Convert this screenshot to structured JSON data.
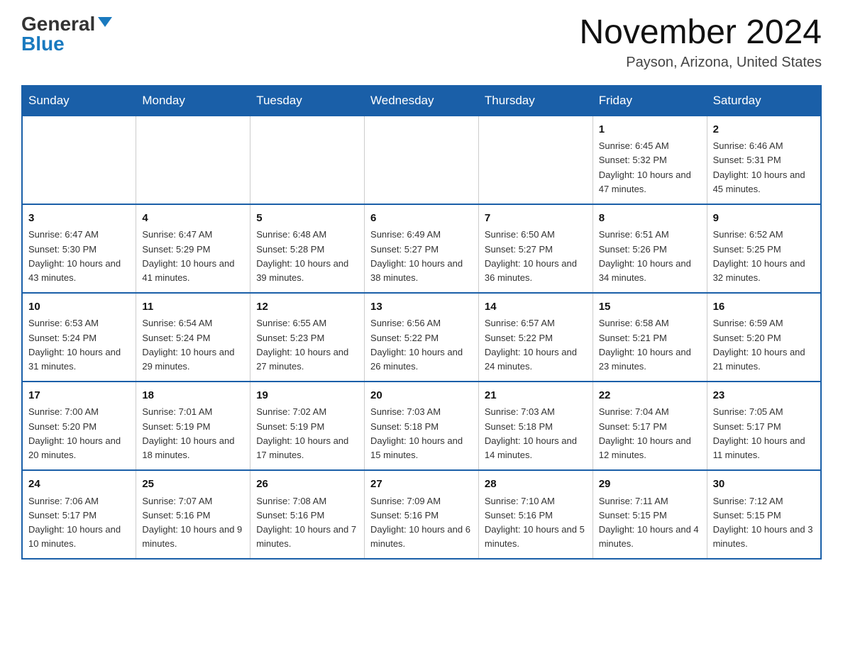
{
  "header": {
    "logo_general": "General",
    "logo_blue": "Blue",
    "title": "November 2024",
    "subtitle": "Payson, Arizona, United States"
  },
  "days_of_week": [
    "Sunday",
    "Monday",
    "Tuesday",
    "Wednesday",
    "Thursday",
    "Friday",
    "Saturday"
  ],
  "weeks": [
    [
      {
        "day": "",
        "info": ""
      },
      {
        "day": "",
        "info": ""
      },
      {
        "day": "",
        "info": ""
      },
      {
        "day": "",
        "info": ""
      },
      {
        "day": "",
        "info": ""
      },
      {
        "day": "1",
        "info": "Sunrise: 6:45 AM\nSunset: 5:32 PM\nDaylight: 10 hours and 47 minutes."
      },
      {
        "day": "2",
        "info": "Sunrise: 6:46 AM\nSunset: 5:31 PM\nDaylight: 10 hours and 45 minutes."
      }
    ],
    [
      {
        "day": "3",
        "info": "Sunrise: 6:47 AM\nSunset: 5:30 PM\nDaylight: 10 hours and 43 minutes."
      },
      {
        "day": "4",
        "info": "Sunrise: 6:47 AM\nSunset: 5:29 PM\nDaylight: 10 hours and 41 minutes."
      },
      {
        "day": "5",
        "info": "Sunrise: 6:48 AM\nSunset: 5:28 PM\nDaylight: 10 hours and 39 minutes."
      },
      {
        "day": "6",
        "info": "Sunrise: 6:49 AM\nSunset: 5:27 PM\nDaylight: 10 hours and 38 minutes."
      },
      {
        "day": "7",
        "info": "Sunrise: 6:50 AM\nSunset: 5:27 PM\nDaylight: 10 hours and 36 minutes."
      },
      {
        "day": "8",
        "info": "Sunrise: 6:51 AM\nSunset: 5:26 PM\nDaylight: 10 hours and 34 minutes."
      },
      {
        "day": "9",
        "info": "Sunrise: 6:52 AM\nSunset: 5:25 PM\nDaylight: 10 hours and 32 minutes."
      }
    ],
    [
      {
        "day": "10",
        "info": "Sunrise: 6:53 AM\nSunset: 5:24 PM\nDaylight: 10 hours and 31 minutes."
      },
      {
        "day": "11",
        "info": "Sunrise: 6:54 AM\nSunset: 5:24 PM\nDaylight: 10 hours and 29 minutes."
      },
      {
        "day": "12",
        "info": "Sunrise: 6:55 AM\nSunset: 5:23 PM\nDaylight: 10 hours and 27 minutes."
      },
      {
        "day": "13",
        "info": "Sunrise: 6:56 AM\nSunset: 5:22 PM\nDaylight: 10 hours and 26 minutes."
      },
      {
        "day": "14",
        "info": "Sunrise: 6:57 AM\nSunset: 5:22 PM\nDaylight: 10 hours and 24 minutes."
      },
      {
        "day": "15",
        "info": "Sunrise: 6:58 AM\nSunset: 5:21 PM\nDaylight: 10 hours and 23 minutes."
      },
      {
        "day": "16",
        "info": "Sunrise: 6:59 AM\nSunset: 5:20 PM\nDaylight: 10 hours and 21 minutes."
      }
    ],
    [
      {
        "day": "17",
        "info": "Sunrise: 7:00 AM\nSunset: 5:20 PM\nDaylight: 10 hours and 20 minutes."
      },
      {
        "day": "18",
        "info": "Sunrise: 7:01 AM\nSunset: 5:19 PM\nDaylight: 10 hours and 18 minutes."
      },
      {
        "day": "19",
        "info": "Sunrise: 7:02 AM\nSunset: 5:19 PM\nDaylight: 10 hours and 17 minutes."
      },
      {
        "day": "20",
        "info": "Sunrise: 7:03 AM\nSunset: 5:18 PM\nDaylight: 10 hours and 15 minutes."
      },
      {
        "day": "21",
        "info": "Sunrise: 7:03 AM\nSunset: 5:18 PM\nDaylight: 10 hours and 14 minutes."
      },
      {
        "day": "22",
        "info": "Sunrise: 7:04 AM\nSunset: 5:17 PM\nDaylight: 10 hours and 12 minutes."
      },
      {
        "day": "23",
        "info": "Sunrise: 7:05 AM\nSunset: 5:17 PM\nDaylight: 10 hours and 11 minutes."
      }
    ],
    [
      {
        "day": "24",
        "info": "Sunrise: 7:06 AM\nSunset: 5:17 PM\nDaylight: 10 hours and 10 minutes."
      },
      {
        "day": "25",
        "info": "Sunrise: 7:07 AM\nSunset: 5:16 PM\nDaylight: 10 hours and 9 minutes."
      },
      {
        "day": "26",
        "info": "Sunrise: 7:08 AM\nSunset: 5:16 PM\nDaylight: 10 hours and 7 minutes."
      },
      {
        "day": "27",
        "info": "Sunrise: 7:09 AM\nSunset: 5:16 PM\nDaylight: 10 hours and 6 minutes."
      },
      {
        "day": "28",
        "info": "Sunrise: 7:10 AM\nSunset: 5:16 PM\nDaylight: 10 hours and 5 minutes."
      },
      {
        "day": "29",
        "info": "Sunrise: 7:11 AM\nSunset: 5:15 PM\nDaylight: 10 hours and 4 minutes."
      },
      {
        "day": "30",
        "info": "Sunrise: 7:12 AM\nSunset: 5:15 PM\nDaylight: 10 hours and 3 minutes."
      }
    ]
  ]
}
